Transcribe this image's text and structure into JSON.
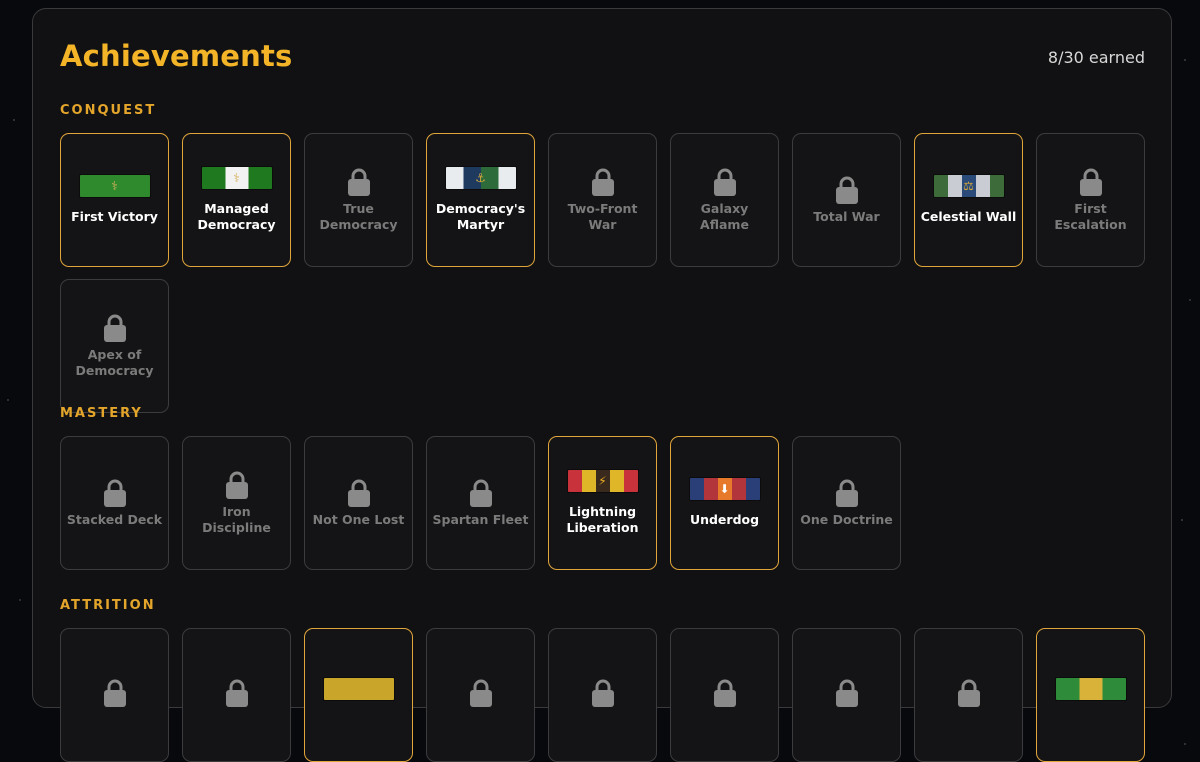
{
  "header": {
    "title": "Achievements",
    "earned_count": "8/30 earned"
  },
  "sections": [
    {
      "label": "CONQUEST",
      "items": [
        {
          "name": "First Victory",
          "earned": true,
          "ribbon_colors": [
            "#2f8a2e",
            "#2f8a2e"
          ],
          "emblem": "⚕",
          "emblem_color": "#d6b25b"
        },
        {
          "name": "Managed Democracy",
          "earned": true,
          "ribbon_colors": [
            "#1f7a1f",
            "#f2f2f2",
            "#1f7a1f"
          ],
          "emblem": "⚕",
          "emblem_color": "#d6b25b"
        },
        {
          "name": "True Democracy",
          "earned": false
        },
        {
          "name": "Democracy's Martyr",
          "earned": true,
          "ribbon_colors": [
            "#e8ecef",
            "#1e3a5f",
            "#2d6b3a",
            "#e8ecef"
          ],
          "emblem": "⚓",
          "emblem_color": "#d6a83a"
        },
        {
          "name": "Two-Front War",
          "earned": false
        },
        {
          "name": "Galaxy Aflame",
          "earned": false
        },
        {
          "name": "Total War",
          "earned": false
        },
        {
          "name": "Celestial Wall",
          "earned": true,
          "ribbon_colors": [
            "#3e6b3a",
            "#c9cdd3",
            "#2a4a7a",
            "#c9cdd3",
            "#3e6b3a"
          ],
          "emblem": "⚖",
          "emblem_color": "#d6a83a"
        },
        {
          "name": "First Escalation",
          "earned": false
        },
        {
          "name": "Apex of Democracy",
          "earned": false
        }
      ]
    },
    {
      "label": "MASTERY",
      "items": [
        {
          "name": "Stacked Deck",
          "earned": false
        },
        {
          "name": "Iron Discipline",
          "earned": false
        },
        {
          "name": "Not One Lost",
          "earned": false
        },
        {
          "name": "Spartan Fleet",
          "earned": false
        },
        {
          "name": "Lightning Liberation",
          "earned": true,
          "ribbon_colors": [
            "#c8323a",
            "#e0b629",
            "#3a2a1e",
            "#e0b629",
            "#c8323a"
          ],
          "emblem": "⚡",
          "emblem_color": "#f0b020"
        },
        {
          "name": "Underdog",
          "earned": true,
          "ribbon_colors": [
            "#2a3f78",
            "#b3353c",
            "#e67a2a",
            "#b3353c",
            "#2a3f78"
          ],
          "emblem": "⬇",
          "emblem_color": "#ffffff"
        },
        {
          "name": "One Doctrine",
          "earned": false
        }
      ]
    },
    {
      "label": "ATTRITION",
      "items": [
        {
          "name": "",
          "earned": false
        },
        {
          "name": "",
          "earned": false
        },
        {
          "name": "",
          "earned": true,
          "ribbon_colors": [
            "#c9a62a",
            "#c9a62a"
          ],
          "emblem": "",
          "emblem_color": "#c9a62a"
        },
        {
          "name": "",
          "earned": false
        },
        {
          "name": "",
          "earned": false
        },
        {
          "name": "",
          "earned": false
        },
        {
          "name": "",
          "earned": false
        },
        {
          "name": "",
          "earned": false
        },
        {
          "name": "",
          "earned": true,
          "ribbon_colors": [
            "#2e8b3a",
            "#d9b23a",
            "#2e8b3a"
          ],
          "emblem": "",
          "emblem_color": "#4fd0c0"
        }
      ]
    }
  ]
}
